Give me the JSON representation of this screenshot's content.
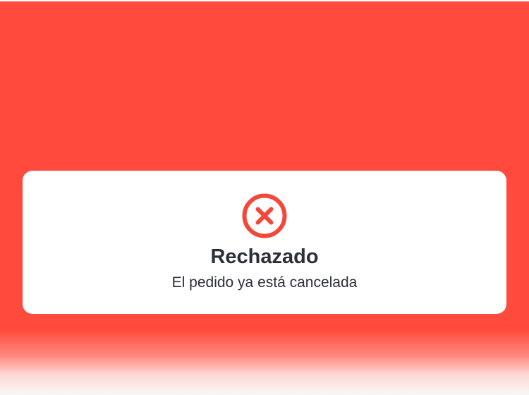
{
  "modal": {
    "icon": "x-circle-icon",
    "title": "Rechazado",
    "message": "El pedido ya está cancelada"
  },
  "colors": {
    "background": "#ff4a3d",
    "card": "#ffffff",
    "icon": "#f4473b",
    "text": "#2b2f3a"
  }
}
